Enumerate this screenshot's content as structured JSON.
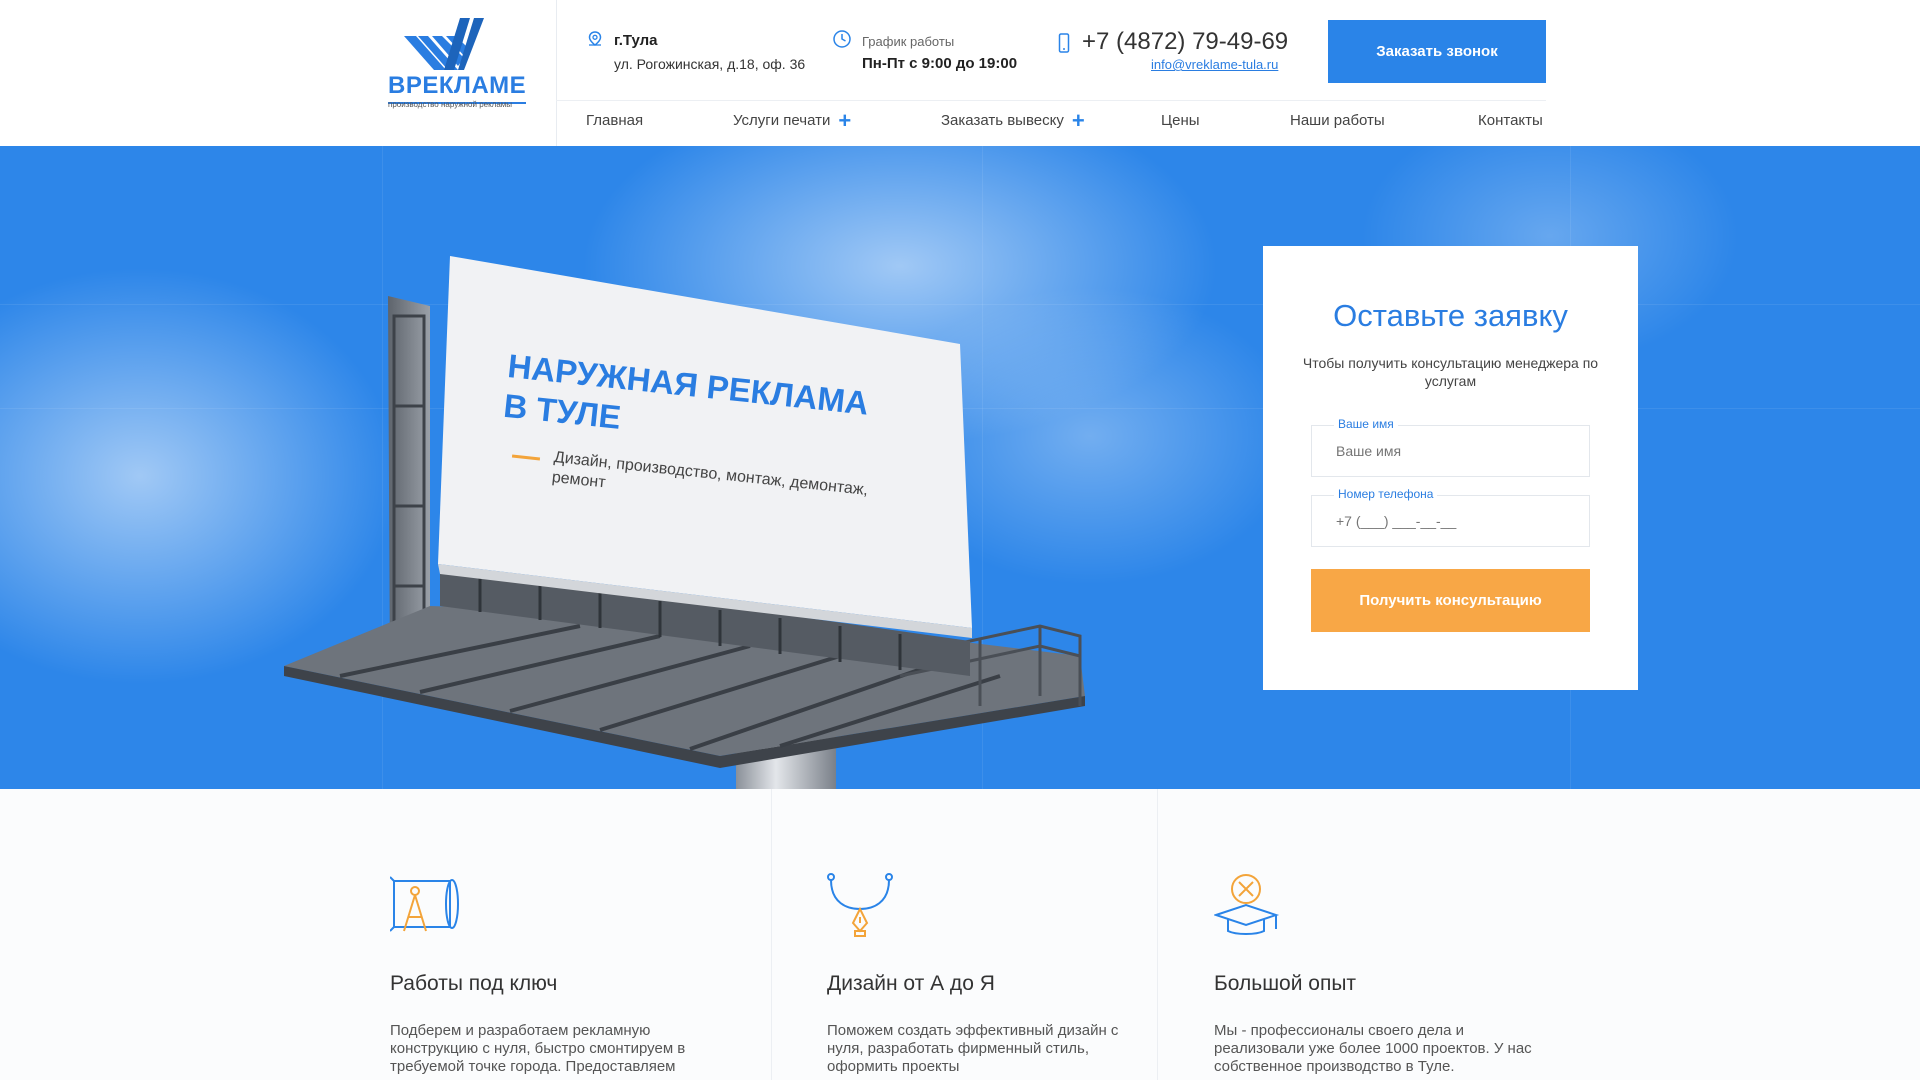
{
  "header": {
    "logo_text": "ВРЕКЛАМЕ",
    "logo_sub": "производство наружной рекламы",
    "city": "г.Тула",
    "address": "ул. Рогожинская, д.18, оф. 36",
    "schedule_label": "График работы",
    "schedule_value": "Пн-Пт с 9:00 до 19:00",
    "phone": "+7 (4872) 79-49-69",
    "email": "info@vreklame-tula.ru",
    "call_button": "Заказать звонок"
  },
  "nav": {
    "items": [
      {
        "label": "Главная"
      },
      {
        "label": "Услуги печати",
        "plus": "+"
      },
      {
        "label": "Заказать вывеску",
        "plus": "+"
      },
      {
        "label": "Цены"
      },
      {
        "label": "Наши работы"
      },
      {
        "label": "Контакты"
      }
    ]
  },
  "hero": {
    "billboard_title_line1": "НАРУЖНАЯ РЕКЛАМА",
    "billboard_title_line2": "В ТУЛЕ",
    "billboard_sub": "Дизайн, производство, монтаж, демонтаж, ремонт"
  },
  "form": {
    "title": "Оставьте заявку",
    "subtitle": "Чтобы получить консультацию менеджера по услугам",
    "name_label": "Ваше имя",
    "name_placeholder": "Ваше имя",
    "phone_label": "Номер телефона",
    "phone_placeholder": "+7 (___) ___-__-__",
    "submit": "Получить консультацию"
  },
  "features": [
    {
      "icon": "blueprint-compass-icon",
      "title": "Работы под ключ",
      "text": "Подберем и разработаем рекламную конструкцию с нуля, быстро смонтируем в требуемой точке города. Предоставляем"
    },
    {
      "icon": "pen-tool-icon",
      "title": "Дизайн от А до Я",
      "text": "Поможем создать эффективный дизайн с нуля, разработать фирменный стиль, оформить проекты"
    },
    {
      "icon": "graduation-cap-icon",
      "title": "Большой опыт",
      "text": "Мы - профессионалы своего дела и реализовали уже более 1000 проектов. У нас собственное производство в Туле."
    }
  ],
  "colors": {
    "accent": "#2a84e8",
    "orange": "#f8a746",
    "hero_bg": "#2d86e9"
  }
}
